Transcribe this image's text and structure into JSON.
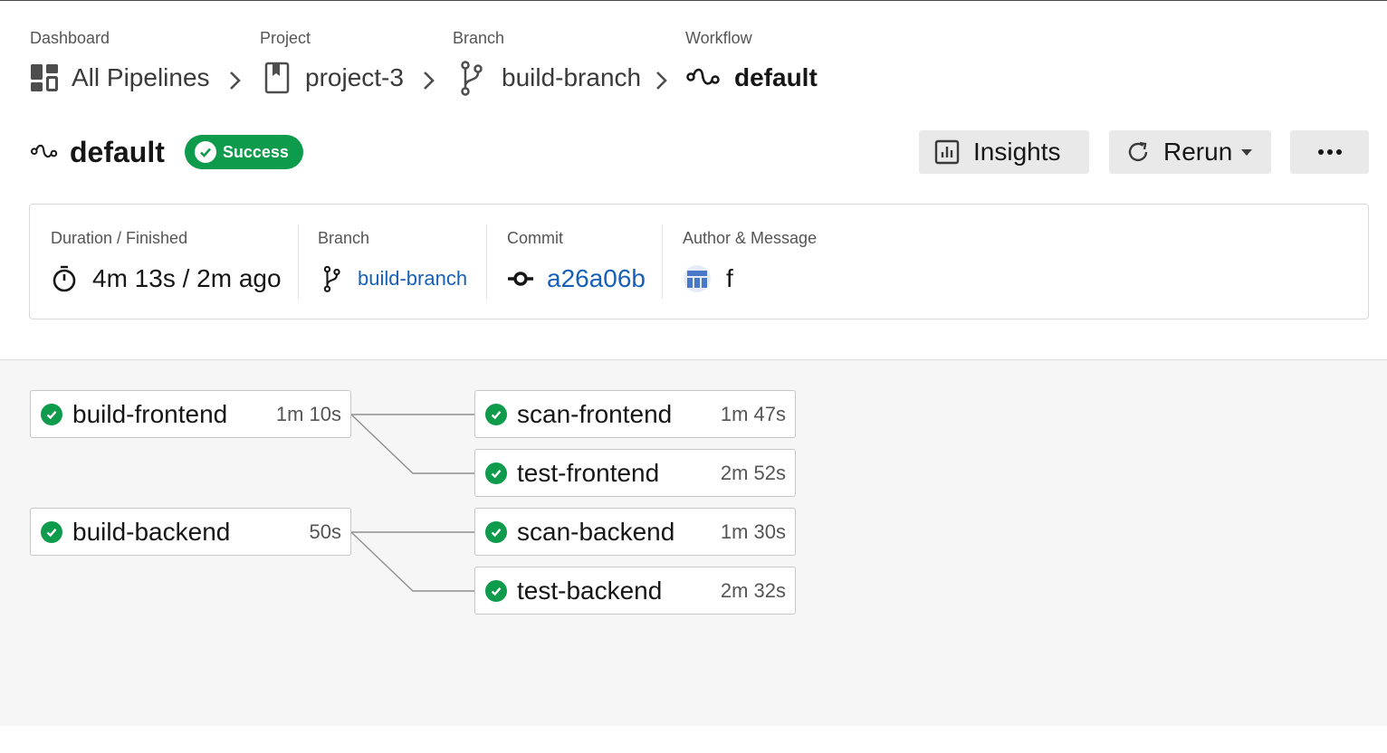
{
  "breadcrumb": {
    "dashboard": {
      "label": "Dashboard",
      "value": "All Pipelines"
    },
    "project": {
      "label": "Project",
      "value": "project-3"
    },
    "branch": {
      "label": "Branch",
      "value": "build-branch"
    },
    "workflow": {
      "label": "Workflow",
      "value": "default"
    }
  },
  "header": {
    "title": "default",
    "status": "Success",
    "insights_label": "Insights",
    "rerun_label": "Rerun"
  },
  "summary": {
    "duration": {
      "label": "Duration / Finished",
      "value": "4m 13s / 2m ago"
    },
    "branch": {
      "label": "Branch",
      "value": "build-branch"
    },
    "commit": {
      "label": "Commit",
      "value": "a26a06b"
    },
    "author": {
      "label": "Author & Message",
      "message": "f"
    }
  },
  "jobs": [
    {
      "name": "build-frontend",
      "duration": "1m 10s",
      "status": "success"
    },
    {
      "name": "scan-frontend",
      "duration": "1m 47s",
      "status": "success"
    },
    {
      "name": "test-frontend",
      "duration": "2m 52s",
      "status": "success"
    },
    {
      "name": "build-backend",
      "duration": "50s",
      "status": "success"
    },
    {
      "name": "scan-backend",
      "duration": "1m 30s",
      "status": "success"
    },
    {
      "name": "test-backend",
      "duration": "2m 32s",
      "status": "success"
    }
  ],
  "colors": {
    "success": "#0e9b4b",
    "link": "#1660b8"
  }
}
